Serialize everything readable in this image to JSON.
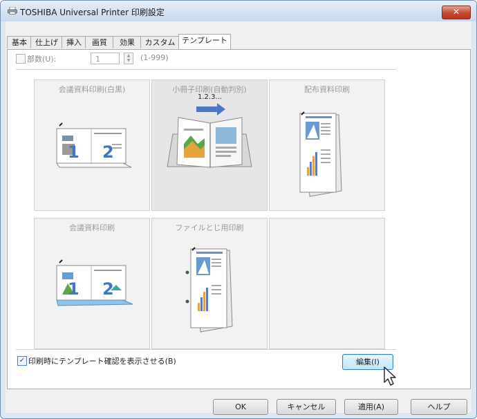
{
  "window": {
    "title": "TOSHIBA Universal Printer 印刷設定",
    "close_label": "✕",
    "icons": [
      "printer-icon",
      "close-icon"
    ]
  },
  "tabs": [
    {
      "label": "基本"
    },
    {
      "label": "仕上げ"
    },
    {
      "label": "挿入"
    },
    {
      "label": "画質"
    },
    {
      "label": "効果"
    },
    {
      "label": "カスタム"
    },
    {
      "label": "テンプレート",
      "active": true
    }
  ],
  "copies": {
    "label": "部数(U):",
    "value": "1",
    "range": "(1-999)",
    "checked": false
  },
  "templates": [
    {
      "label": "会議資料印刷(白黒)"
    },
    {
      "label": "小冊子印刷(自動判別)",
      "selected": true,
      "annotation": "1.2.3..."
    },
    {
      "label": "配布資料印刷"
    },
    {
      "label": "会議資料印刷"
    },
    {
      "label": "ファイルとじ用印刷"
    },
    {
      "label": ""
    }
  ],
  "confirm": {
    "label": "印刷時にテンプレート確認を表示させる(B)",
    "checked": true,
    "check_glyph": "✓"
  },
  "edit_button": {
    "label": "編集(I)"
  },
  "buttons": {
    "ok": "OK",
    "cancel": "キャンセル",
    "apply": "適用(A)",
    "help": "ヘルプ"
  },
  "colors": {
    "title_bar": "#c9d9ec",
    "close_button": "#c8452f",
    "edit_button": "#bee6fd",
    "arrow": "#4a78c8"
  }
}
